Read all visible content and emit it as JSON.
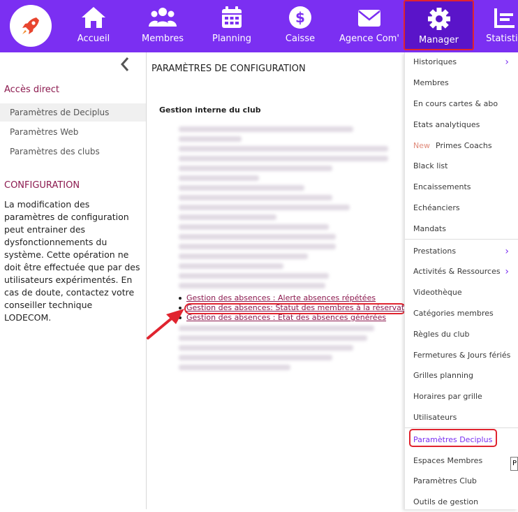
{
  "nav": {
    "items": [
      {
        "label": "Accueil",
        "icon": "home-icon"
      },
      {
        "label": "Membres",
        "icon": "users-icon"
      },
      {
        "label": "Planning",
        "icon": "calendar-icon"
      },
      {
        "label": "Caisse",
        "icon": "dollar-icon"
      },
      {
        "label": "Agence Com'",
        "icon": "mail-icon"
      },
      {
        "label": "Manager",
        "icon": "gear-icon"
      },
      {
        "label": "Statistiq",
        "icon": "chart-icon"
      }
    ],
    "active": "Manager",
    "colors": {
      "bar": "#7b2ff2",
      "active": "#5a14c9",
      "highlight": "#e0242f",
      "accent": "#8c1a4f"
    }
  },
  "sidebar": {
    "acces_direct": "Accès direct",
    "links": [
      "Paramètres de Deciplus",
      "Paramètres Web",
      "Paramètres des clubs"
    ],
    "config_title": "CONFIGURATION",
    "config_text": "La modification des paramètres de configuration peut entrainer des dysfonctionnements du système. Cette opération ne doit être effectuée que par des utilisateurs expérimentés. En cas de doute, contactez votre conseiller technique LODECOM."
  },
  "main": {
    "title": "PARAMÈTRES DE CONFIGURATION",
    "section": "Gestion interne du club",
    "links": [
      "Gestion des absences : Alerte absences répétées",
      "Gestion des absences: Statut des membres à la réservation",
      "Gestion des absences : Etat des absences générées"
    ]
  },
  "dropdown": {
    "items": [
      {
        "label": "Historiques",
        "chevron": true
      },
      {
        "label": "Membres"
      },
      {
        "label": "En cours cartes & abo"
      },
      {
        "label": "Etats analytiques"
      },
      {
        "label": "Primes Coachs",
        "badge": "New"
      },
      {
        "label": "Black list"
      },
      {
        "label": "Encaissements"
      },
      {
        "label": "Echéanciers"
      },
      {
        "label": "Mandats"
      },
      {
        "label": "Prestations",
        "chevron": true
      },
      {
        "label": "Activités & Ressources",
        "chevron": true
      },
      {
        "label": "Videothèque"
      },
      {
        "label": "Catégories membres"
      },
      {
        "label": "Règles du club"
      },
      {
        "label": "Fermetures & Jours fériés"
      },
      {
        "label": "Grilles planning"
      },
      {
        "label": "Horaires par grille"
      },
      {
        "label": "Utilisateurs"
      },
      {
        "label": "Paramètres Deciplus"
      },
      {
        "label": "Espaces Membres"
      },
      {
        "label": "Paramètres Club"
      },
      {
        "label": "Outils de gestion"
      }
    ]
  }
}
